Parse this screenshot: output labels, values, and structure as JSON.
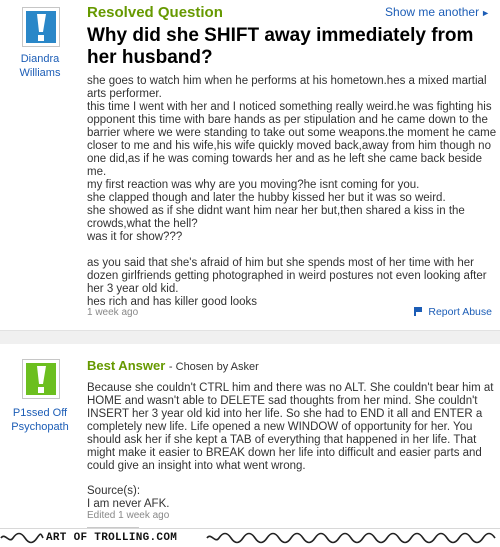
{
  "question": {
    "status_label": "Resolved Question",
    "show_another_label": "Show me another",
    "title": "Why did she SHIFT away immediately from her husband?",
    "asker_name": "Diandra Williams",
    "body": "she goes to watch him when he performs at his hometown.hes a mixed martial arts performer.\nthis time I went with her and I noticed something really weird.he was fighting his opponent this time with bare hands as per stipulation and he came down to the barrier where we were standing to take out some weapons.the moment he came closer to me and his wife,his wife quickly moved back,away from him though no one did,as if he was coming towards her and as he left she came back beside me.\nmy first reaction was why are you moving?he isnt coming for you.\nshe clapped though and later the hubby kissed her but it was so weird.\nshe showed as if she didnt want him near her but,then shared a kiss in the crowds,what the hell?\nwas it for show???\n\nas you said that she's afraid of him but she spends most of her time with her dozen girlfriends getting photographed in weird postures not even looking after her 3 year old kid.\nhes rich and has killer good looks",
    "time_ago": "1 week ago",
    "report_label": "Report Abuse"
  },
  "answer": {
    "best_label": "Best Answer",
    "chosen_label": "- Chosen by Asker",
    "answerer_name": "P1ssed Off Psychopath",
    "body": "Because she couldn't CTRL him and there was no ALT. She couldn't bear him at HOME and wasn't able to DELETE sad thoughts from her mind. She couldn't INSERT her 3 year old kid into her life. So she had to END it all and ENTER a completely new life. Life opened a new WINDOW of opportunity for her. You should ask her if she kept a TAB of everything that happened in her life. That might make it easier to BREAK down her life into difficult and easier parts and could give an insight into what went wrong.",
    "sources_label": "Source(s):",
    "sources_value": "I am never AFK.",
    "edited_label": "Edited 1 week ago"
  },
  "watermark": {
    "text": "ART OF TROLLING.COM"
  },
  "colors": {
    "brand_green": "#669900",
    "link_blue": "#1c5db6",
    "avatar_blue": "#2a87c8",
    "avatar_green": "#6cbf1f"
  },
  "icons": [
    "exclamation-avatar-icon",
    "flag-icon",
    "thumbs-icon"
  ]
}
